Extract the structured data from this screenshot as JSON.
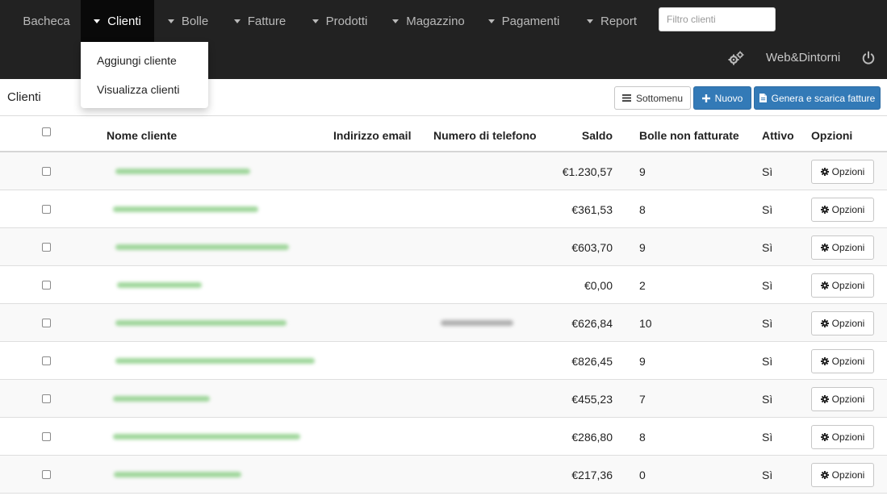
{
  "nav": {
    "items": [
      {
        "label": "Bacheca",
        "caret": false,
        "active": false
      },
      {
        "label": "Clienti",
        "caret": true,
        "active": true
      },
      {
        "label": "Bolle",
        "caret": true,
        "active": false
      },
      {
        "label": "Fatture",
        "caret": true,
        "active": false
      },
      {
        "label": "Prodotti",
        "caret": true,
        "active": false
      },
      {
        "label": "Magazzino",
        "caret": true,
        "active": false
      },
      {
        "label": "Pagamenti",
        "caret": true,
        "active": false
      },
      {
        "label": "Report",
        "caret": true,
        "active": false
      }
    ],
    "filter_placeholder": "Filtro clienti",
    "filter_value": "",
    "brand": "Web&Dintorni",
    "settings_icon": "gears-icon",
    "logout_icon": "power-icon"
  },
  "dropdown": {
    "items": [
      "Aggiungi cliente",
      "Visualizza clienti"
    ]
  },
  "toolbar": {
    "title": "Clienti",
    "submenu_label": "Sottomenu",
    "new_label": "Nuovo",
    "generate_label": "Genera e scarica fatture"
  },
  "table": {
    "headers": {
      "name": "Nome cliente",
      "email": "Indirizzo email",
      "phone": "Numero di telefono",
      "balance": "Saldo",
      "unbilled": "Bolle non fatturate",
      "active": "Attivo",
      "options": "Opzioni"
    },
    "option_label": "Opzioni",
    "rows": [
      {
        "balance": "€1.230,57",
        "unbilled": "9",
        "active": "Sì"
      },
      {
        "balance": "€361,53",
        "unbilled": "8",
        "active": "Sì"
      },
      {
        "balance": "€603,70",
        "unbilled": "9",
        "active": "Sì"
      },
      {
        "balance": "€0,00",
        "unbilled": "2",
        "active": "Sì"
      },
      {
        "balance": "€626,84",
        "unbilled": "10",
        "active": "Sì"
      },
      {
        "balance": "€826,45",
        "unbilled": "9",
        "active": "Sì"
      },
      {
        "balance": "€455,23",
        "unbilled": "7",
        "active": "Sì"
      },
      {
        "balance": "€286,80",
        "unbilled": "8",
        "active": "Sì"
      },
      {
        "balance": "€217,36",
        "unbilled": "0",
        "active": "Sì"
      }
    ]
  },
  "colors": {
    "navbar": "#222222",
    "nav_active": "#090909",
    "primary": "#337ab7",
    "row_alt": "#f9f9f9"
  }
}
